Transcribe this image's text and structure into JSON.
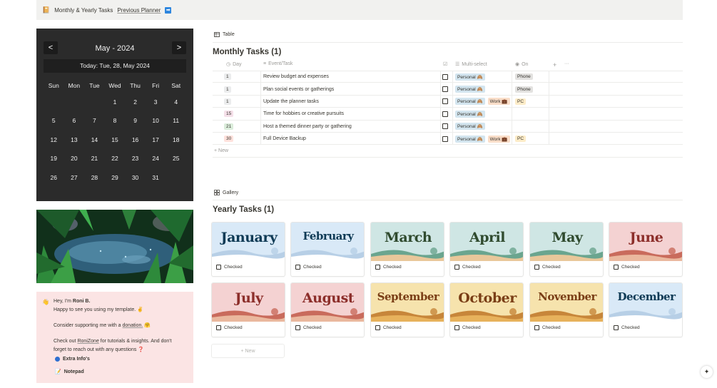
{
  "topbar": {
    "icon": "planner-emoji",
    "title": "Monthly & Yearly Tasks",
    "link": "Previous Planner",
    "arrow": "➡"
  },
  "calendar": {
    "prev": "<",
    "next": ">",
    "month": "May",
    "sep": "-",
    "year": "2024",
    "today": "Today: Tue, 28, May 2024",
    "weekdays": [
      "Sun",
      "Mon",
      "Tue",
      "Wed",
      "Thu",
      "Fri",
      "Sat"
    ],
    "days": [
      "",
      "",
      "",
      "1",
      "2",
      "3",
      "4",
      "5",
      "6",
      "7",
      "8",
      "9",
      "10",
      "11",
      "12",
      "13",
      "14",
      "15",
      "16",
      "17",
      "18",
      "19",
      "20",
      "21",
      "22",
      "23",
      "24",
      "25",
      "26",
      "27",
      "28",
      "29",
      "30",
      "31",
      ""
    ]
  },
  "info": {
    "greeting": "Hey, I'm",
    "name": "Roni B.",
    "happy": "Happy to see you using my template.",
    "happy_emoji": "✌",
    "support_pre": "Consider supporting me with a",
    "support_link": "donation.",
    "support_emoji": "🤗",
    "check_pre": "Check out",
    "check_link": "RoniZone",
    "check_post": "for tutorials & insights. And don't",
    "forget": "forget to reach out with any questions",
    "forget_emoji": "❓",
    "extra": "Extra Info's",
    "notepad": "Notepad"
  },
  "table": {
    "view": "Table",
    "title": "Monthly Tasks (1)",
    "headers": {
      "day": "Day",
      "event": "Event/Task",
      "multi": "Multi-select",
      "on": "On",
      "add": "+",
      "more": "···"
    },
    "rows": [
      {
        "day": "1",
        "task": "Review budget and expenses",
        "tags": [
          "Personal 🙈"
        ],
        "on": [
          "Phone"
        ],
        "day_color": "#ebeced"
      },
      {
        "day": "1",
        "task": "Plan social events or gatherings",
        "tags": [
          "Personal 🙈"
        ],
        "on": [
          "Phone"
        ],
        "day_color": "#ebeced"
      },
      {
        "day": "1",
        "task": "Update the planner tasks",
        "tags": [
          "Personal 🙈",
          "Work 💼"
        ],
        "on": [
          "PC"
        ],
        "day_color": "#ebeced"
      },
      {
        "day": "15",
        "task": "Time for hobbies or creative pursuits",
        "tags": [
          "Personal 🙈"
        ],
        "on": [],
        "day_color": "#f5e0e9"
      },
      {
        "day": "21",
        "task": "Host a themed dinner party or gathering",
        "tags": [
          "Personal 🙈"
        ],
        "on": [],
        "day_color": "#dbeddb"
      },
      {
        "day": "30",
        "task": "Full Device Backup",
        "tags": [
          "Personal 🙈",
          "Work 💼"
        ],
        "on": [
          "PC"
        ],
        "day_color": "#ffe2dd"
      }
    ],
    "new": "+ New"
  },
  "gallery": {
    "view": "Gallery",
    "title": "Yearly Tasks (1)",
    "checked": "Checked",
    "new": "+ New",
    "months": [
      {
        "name": "January",
        "theme": "winter"
      },
      {
        "name": "February",
        "theme": "winter"
      },
      {
        "name": "March",
        "theme": "spring"
      },
      {
        "name": "April",
        "theme": "spring"
      },
      {
        "name": "May",
        "theme": "spring"
      },
      {
        "name": "June",
        "theme": "summer"
      },
      {
        "name": "July",
        "theme": "summer"
      },
      {
        "name": "August",
        "theme": "summer"
      },
      {
        "name": "September",
        "theme": "autumn"
      },
      {
        "name": "October",
        "theme": "autumn"
      },
      {
        "name": "November",
        "theme": "autumn"
      },
      {
        "name": "December",
        "theme": "winter"
      }
    ]
  },
  "colors": {
    "winter": "#d9e9f7",
    "spring": "#cfe6e4",
    "summer": "#f4d2d2",
    "autumn": "#f6e3ad",
    "text_winter": "#0e3a55",
    "text_spring": "#2f4a2e",
    "text_summer": "#8c2e2a",
    "text_autumn": "#7a3e16"
  }
}
